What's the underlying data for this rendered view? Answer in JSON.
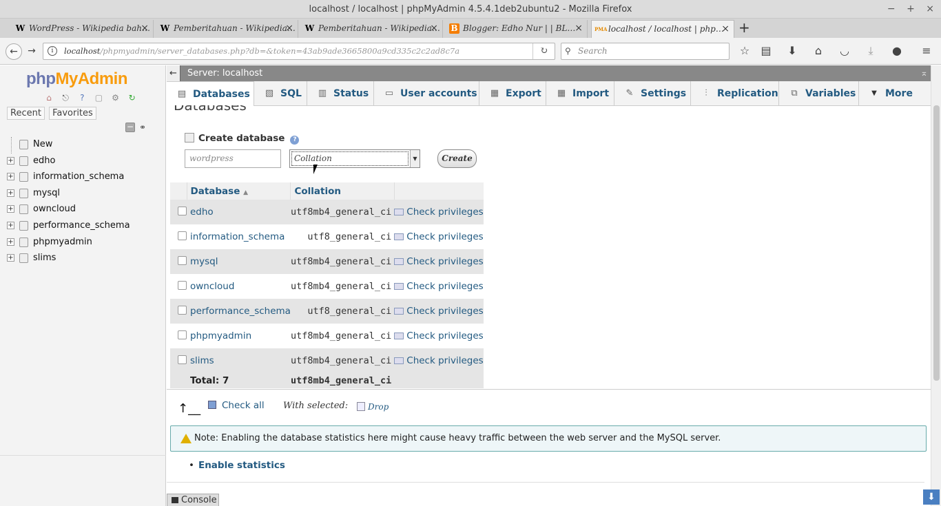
{
  "window": {
    "title": "localhost / localhost | phpMyAdmin 4.5.4.1deb2ubuntu2 - Mozilla Firefox",
    "controls": [
      "−",
      "+",
      "×"
    ]
  },
  "tabs": [
    {
      "label": "WordPress - Wikipedia bah…",
      "favicon": "W"
    },
    {
      "label": "Pemberitahuan - Wikipedia…",
      "favicon": "W"
    },
    {
      "label": "Pemberitahuan - Wikipedia…",
      "favicon": "W"
    },
    {
      "label": "Blogger: Edho Nur | | BL…",
      "favicon": "B"
    },
    {
      "label": "localhost / localhost | php…",
      "favicon": "PMA"
    }
  ],
  "newtab": "+",
  "url": {
    "host": "localhost",
    "path": "/phpmyadmin/server_databases.php?db=&token=43ab9ade3665800a9cd335c2c2ad8c7a"
  },
  "search": {
    "placeholder": "Search"
  },
  "colors": {
    "link": "#235a81",
    "logo_php": "#6c78af",
    "logo_myadmin": "#f89c0e",
    "server_bar": "#888888"
  },
  "sidebar": {
    "logo_php": "php",
    "logo_myadmin": "MyAdmin",
    "links": [
      "Recent",
      "Favorites"
    ],
    "tree": [
      {
        "label": "New"
      },
      {
        "label": "edho"
      },
      {
        "label": "information_schema"
      },
      {
        "label": "mysql"
      },
      {
        "label": "owncloud"
      },
      {
        "label": "performance_schema"
      },
      {
        "label": "phpmyadmin"
      },
      {
        "label": "slims"
      }
    ]
  },
  "server": {
    "label": "Server: localhost"
  },
  "menu": [
    {
      "label": "Databases",
      "icon": "database-icon"
    },
    {
      "label": "SQL",
      "icon": "sql-icon"
    },
    {
      "label": "Status",
      "icon": "status-icon"
    },
    {
      "label": "User accounts",
      "icon": "users-icon"
    },
    {
      "label": "Export",
      "icon": "export-icon"
    },
    {
      "label": "Import",
      "icon": "import-icon"
    },
    {
      "label": "Settings",
      "icon": "wrench-icon"
    },
    {
      "label": "Replication",
      "icon": "replication-icon"
    },
    {
      "label": "Variables",
      "icon": "variables-icon"
    },
    {
      "label": "More",
      "icon": "chevron-down-icon"
    }
  ],
  "page_title_partial": "Databases",
  "create": {
    "heading": "Create database",
    "name_placeholder": "wordpress",
    "collation_value": "Collation",
    "button": "Create"
  },
  "table": {
    "headers": {
      "database": "Database",
      "collation": "Collation"
    },
    "rows": [
      {
        "name": "edho",
        "collation": "utf8mb4_general_ci",
        "action": "Check privileges"
      },
      {
        "name": "information_schema",
        "collation": "utf8_general_ci",
        "action": "Check privileges"
      },
      {
        "name": "mysql",
        "collation": "utf8mb4_general_ci",
        "action": "Check privileges"
      },
      {
        "name": "owncloud",
        "collation": "utf8mb4_general_ci",
        "action": "Check privileges"
      },
      {
        "name": "performance_schema",
        "collation": "utf8_general_ci",
        "action": "Check privileges"
      },
      {
        "name": "phpmyadmin",
        "collation": "utf8mb4_general_ci",
        "action": "Check privileges"
      },
      {
        "name": "slims",
        "collation": "utf8mb4_general_ci",
        "action": "Check privileges"
      }
    ],
    "total_label": "Total: 7",
    "total_collation": "utf8mb4_general_ci"
  },
  "bulk": {
    "check_all": "Check all",
    "with_selected": "With selected:",
    "drop": "Drop"
  },
  "notice": "Note: Enabling the database statistics here might cause heavy traffic between the web server and the MySQL server.",
  "enable_stats": "Enable statistics",
  "console": "Console"
}
